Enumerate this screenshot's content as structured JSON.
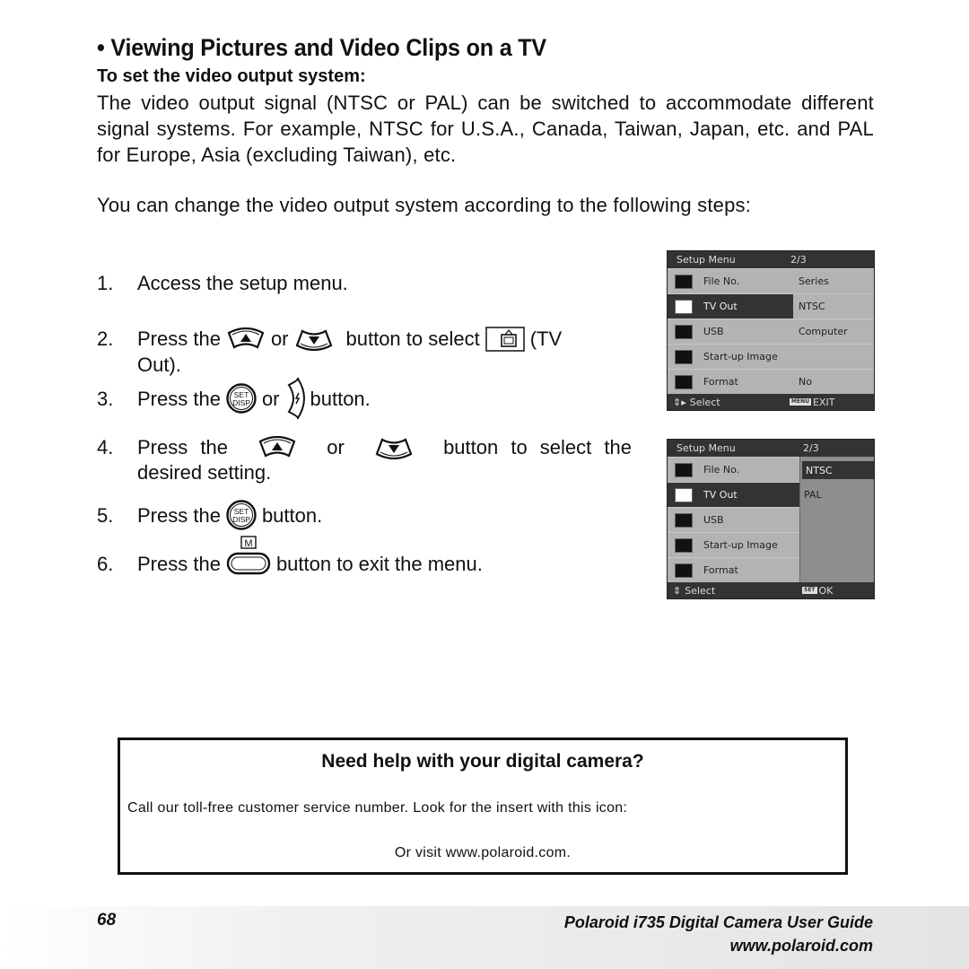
{
  "header": {
    "title": "• Viewing Pictures and Video Clips on a TV",
    "subheading": "To set the video output system:"
  },
  "body": {
    "intro": "The video output signal (NTSC or PAL) can be switched to accommodate different signal systems. For example, NTSC for U.S.A., Canada, Taiwan, Japan, etc. and PAL for Europe, Asia (excluding Taiwan), etc.",
    "lead": "You can change the video output system according to the following steps:"
  },
  "steps": [
    {
      "num": "1.",
      "parts": [
        "Access the setup menu."
      ]
    },
    {
      "num": "2.",
      "parts": [
        "Press the",
        "or",
        "button to select",
        "(TV"
      ],
      "continuation": "Out)."
    },
    {
      "num": "3.",
      "parts": [
        "Press the",
        "or",
        "button."
      ]
    },
    {
      "num": "4.",
      "parts": [
        "Press the",
        "or",
        "button to select the"
      ],
      "continuation": "desired setting."
    },
    {
      "num": "5.",
      "parts": [
        "Press the",
        "button."
      ]
    },
    {
      "num": "6.",
      "parts": [
        "Press the",
        "button to exit the menu."
      ]
    }
  ],
  "icons": {
    "up_button": "up-arrow-button",
    "down_button": "down-arrow-button",
    "set_disp_button": "SET DISP",
    "flash_button": "flash-right-button",
    "menu_button_label": "M",
    "tv_out": "tv-icon"
  },
  "menu1": {
    "title": "Setup Menu",
    "page": "2/3",
    "items": [
      {
        "label": "File No.",
        "value": "Series",
        "icon": "file-no-icon"
      },
      {
        "label": "TV Out",
        "value": "NTSC",
        "icon": "tv-icon",
        "selected": true
      },
      {
        "label": "USB",
        "value": "Computer",
        "icon": "usb-icon"
      },
      {
        "label": "Start-up Image",
        "value": "",
        "icon": "startup-image-icon"
      },
      {
        "label": "Format",
        "value": "No",
        "icon": "format-icon"
      }
    ],
    "footer_left": "Select",
    "footer_key": "MENU",
    "footer_right": "EXIT"
  },
  "menu2": {
    "title": "Setup Menu",
    "page": "2/3",
    "items": [
      {
        "label": "File No.",
        "icon": "file-no-icon"
      },
      {
        "label": "TV Out",
        "icon": "tv-icon",
        "selected": true
      },
      {
        "label": "USB",
        "icon": "usb-icon"
      },
      {
        "label": "Start-up Image",
        "icon": "startup-image-icon"
      },
      {
        "label": "Format",
        "icon": "format-icon"
      }
    ],
    "options": [
      {
        "label": "NTSC",
        "selected": true
      },
      {
        "label": "PAL",
        "selected": false
      }
    ],
    "footer_left": "Select",
    "footer_key": "SET",
    "footer_right": "OK"
  },
  "help": {
    "heading": "Need help with your digital camera?",
    "line1": "Call our toll-free customer service number. Look for the insert with this icon:",
    "line2": "Or visit www.polaroid.com."
  },
  "footer": {
    "page_number": "68",
    "guide_title": "Polaroid i735 Digital Camera User Guide",
    "website": "www.polaroid.com"
  }
}
